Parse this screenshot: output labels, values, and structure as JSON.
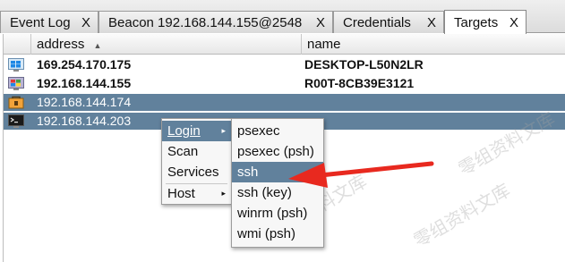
{
  "tabs": [
    {
      "label": "Event Log",
      "close": "X"
    },
    {
      "label": "Beacon 192.168.144.155@2548",
      "close": "X"
    },
    {
      "label": "Credentials",
      "close": "X"
    },
    {
      "label": "Targets",
      "close": "X"
    }
  ],
  "table": {
    "columns": [
      "address",
      "name"
    ],
    "sort_indicator": "▲",
    "rows": [
      {
        "address": "169.254.170.175",
        "name": "DESKTOP-L50N2LR",
        "icon": "windows-desktop-icon"
      },
      {
        "address": "192.168.144.155",
        "name": "R00T-8CB39E3121",
        "icon": "windows-server-icon"
      },
      {
        "address": "192.168.144.174",
        "name": "",
        "icon": "firewall-lock-icon"
      },
      {
        "address": "192.168.144.203",
        "name": "",
        "icon": "terminal-icon"
      }
    ]
  },
  "context_menu": {
    "items": [
      {
        "label": "Login",
        "submenu": true
      },
      {
        "label": "Scan",
        "submenu": false
      },
      {
        "label": "Services",
        "submenu": false
      },
      {
        "label": "Host",
        "submenu": true
      }
    ],
    "submenu_arrow": "▸"
  },
  "login_submenu": {
    "items": [
      "psexec",
      "psexec (psh)",
      "ssh",
      "ssh (key)",
      "winrm (psh)",
      "wmi (psh)"
    ]
  },
  "colors": {
    "selection": "#61819c",
    "arrow": "#e8291f"
  },
  "watermark": "零组资料文库"
}
